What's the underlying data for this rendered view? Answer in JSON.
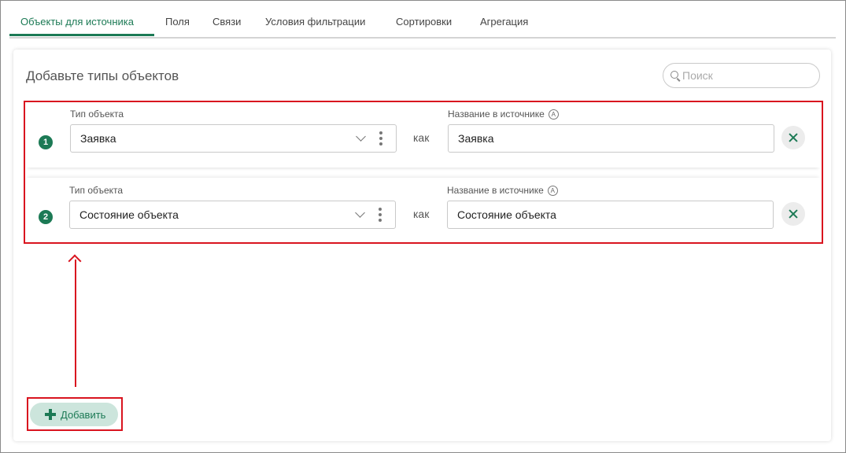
{
  "tabs": [
    {
      "label": "Объекты для источника",
      "active": true
    },
    {
      "label": "Поля"
    },
    {
      "label": "Связи"
    },
    {
      "label": "Условия фильтрации"
    },
    {
      "label": "Сортировки"
    },
    {
      "label": "Агрегация"
    }
  ],
  "panel": {
    "title": "Добавьте типы объектов",
    "search_placeholder": "Поиск"
  },
  "rows": [
    {
      "index": "1",
      "type_label": "Тип объекта",
      "type_value": "Заявка",
      "as_label": "как",
      "name_label": "Название в источнике",
      "name_icon": "A",
      "name_value": "Заявка"
    },
    {
      "index": "2",
      "type_label": "Тип объекта",
      "type_value": "Состояние объекта",
      "as_label": "как",
      "name_label": "Название в источнике",
      "name_icon": "A",
      "name_value": "Состояние объекта"
    }
  ],
  "add_button": {
    "label": "Добавить"
  },
  "colors": {
    "accent": "#1c7a55",
    "highlight": "#d9141f",
    "add_bg": "#cce5dc"
  },
  "icons": [
    "search-icon",
    "chevron-down-icon",
    "kebab-menu-icon",
    "close-icon",
    "plus-icon",
    "arrow-up-icon"
  ]
}
